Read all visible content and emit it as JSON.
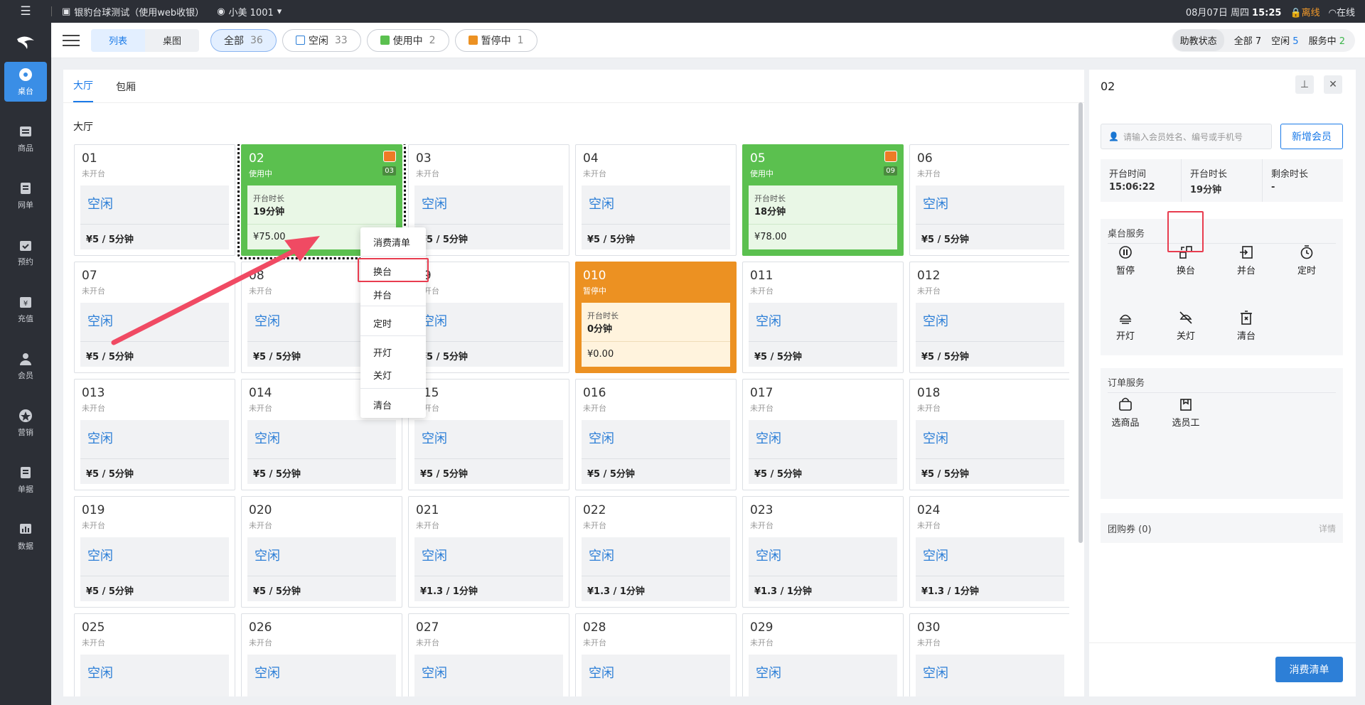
{
  "topbar": {
    "store": "银豹台球测试（使用web收银）",
    "user": "小美 1001",
    "date": "08月07日 周四",
    "time": "15:25",
    "offline": "离线",
    "online": "在线"
  },
  "sidebar": [
    {
      "label": "桌台",
      "icon": "table-icon"
    },
    {
      "label": "商品",
      "icon": "goods-icon"
    },
    {
      "label": "网单",
      "icon": "online-order-icon"
    },
    {
      "label": "预约",
      "icon": "calendar-icon"
    },
    {
      "label": "充值",
      "icon": "recharge-icon"
    },
    {
      "label": "会员",
      "icon": "member-icon"
    },
    {
      "label": "营销",
      "icon": "star-icon"
    },
    {
      "label": "单据",
      "icon": "document-icon"
    },
    {
      "label": "数据",
      "icon": "chart-icon"
    }
  ],
  "header": {
    "view_list": "列表",
    "view_table": "桌图",
    "filters": [
      {
        "label": "全部",
        "count": "36"
      },
      {
        "label": "空闲",
        "count": "33"
      },
      {
        "label": "使用中",
        "count": "2"
      },
      {
        "label": "暂停中",
        "count": "1"
      }
    ],
    "assist": {
      "label": "助教状态",
      "all": "全部",
      "all_count": "7",
      "idle": "空闲",
      "idle_count": "5",
      "serving": "服务中",
      "serving_count": "2"
    }
  },
  "tabs": [
    "大厅",
    "包厢"
  ],
  "section": "大厅",
  "status_text": {
    "idle": "未开台",
    "using": "使用中",
    "paused": "暂停中",
    "idle_big": "空闲",
    "duration_label": "开台时长"
  },
  "tables": [
    {
      "name": "01",
      "state": "idle",
      "price": "¥5 / 5分钟"
    },
    {
      "name": "02",
      "state": "using",
      "duration": "19分钟",
      "amount": "¥75.00",
      "badge": "03",
      "selected": true
    },
    {
      "name": "03",
      "state": "idle",
      "price": "¥5 / 5分钟"
    },
    {
      "name": "04",
      "state": "idle",
      "price": "¥5 / 5分钟"
    },
    {
      "name": "05",
      "state": "using",
      "duration": "18分钟",
      "amount": "¥78.00",
      "badge": "09"
    },
    {
      "name": "06",
      "state": "idle",
      "price": "¥5 / 5分钟"
    },
    {
      "name": "07",
      "state": "idle",
      "price": "¥5 / 5分钟"
    },
    {
      "name": "08",
      "state": "idle",
      "price": "¥5 / 5分钟"
    },
    {
      "name": "09",
      "state": "idle",
      "price": "¥5 / 5分钟"
    },
    {
      "name": "010",
      "state": "paused",
      "duration": "0分钟",
      "amount": "¥0.00"
    },
    {
      "name": "011",
      "state": "idle",
      "price": "¥5 / 5分钟"
    },
    {
      "name": "012",
      "state": "idle",
      "price": "¥5 / 5分钟"
    },
    {
      "name": "013",
      "state": "idle",
      "price": "¥5 / 5分钟"
    },
    {
      "name": "014",
      "state": "idle",
      "price": "¥5 / 5分钟"
    },
    {
      "name": "015",
      "state": "idle",
      "price": "¥5 / 5分钟"
    },
    {
      "name": "016",
      "state": "idle",
      "price": "¥5 / 5分钟"
    },
    {
      "name": "017",
      "state": "idle",
      "price": "¥5 / 5分钟"
    },
    {
      "name": "018",
      "state": "idle",
      "price": "¥5 / 5分钟"
    },
    {
      "name": "019",
      "state": "idle",
      "price": "¥5 / 5分钟"
    },
    {
      "name": "020",
      "state": "idle",
      "price": "¥5 / 5分钟"
    },
    {
      "name": "021",
      "state": "idle",
      "price": "¥1.3 / 1分钟"
    },
    {
      "name": "022",
      "state": "idle",
      "price": "¥1.3 / 1分钟"
    },
    {
      "name": "023",
      "state": "idle",
      "price": "¥1.3 / 1分钟"
    },
    {
      "name": "024",
      "state": "idle",
      "price": "¥1.3 / 1分钟"
    },
    {
      "name": "025",
      "state": "idle",
      "price": ""
    },
    {
      "name": "026",
      "state": "idle",
      "price": ""
    },
    {
      "name": "027",
      "state": "idle",
      "price": ""
    },
    {
      "name": "028",
      "state": "idle",
      "price": ""
    },
    {
      "name": "029",
      "state": "idle",
      "price": ""
    },
    {
      "name": "030",
      "state": "idle",
      "price": ""
    }
  ],
  "context_menu": [
    "消费清单",
    "换台",
    "并台",
    "定时",
    "开灯",
    "关灯",
    "清台"
  ],
  "panel": {
    "title": "02",
    "search_placeholder": "请输入会员姓名、编号或手机号",
    "new_member": "新增会员",
    "start_time_label": "开台时间",
    "start_time": "15:06:22",
    "duration_label": "开台时长",
    "duration": "19分钟",
    "remaining_label": "剩余时长",
    "remaining": "-",
    "table_services_title": "桌台服务",
    "table_services": [
      {
        "label": "暂停",
        "icon": "pause-icon"
      },
      {
        "label": "换台",
        "icon": "swap-table-icon"
      },
      {
        "label": "并台",
        "icon": "merge-table-icon"
      },
      {
        "label": "定时",
        "icon": "timer-icon"
      },
      {
        "label": "开灯",
        "icon": "light-on-icon"
      },
      {
        "label": "关灯",
        "icon": "light-off-icon"
      },
      {
        "label": "清台",
        "icon": "clear-table-icon"
      }
    ],
    "order_services_title": "订单服务",
    "order_services": [
      {
        "label": "选商品",
        "icon": "shopping-bag-icon"
      },
      {
        "label": "选员工",
        "icon": "staff-icon"
      }
    ],
    "group_coupon": "团购券 (0)",
    "details": "详情",
    "bill_button": "消费清单"
  },
  "colors": {
    "primary": "#2d7fd7",
    "using": "#5bc04f",
    "paused": "#ec9122",
    "highlight": "#e83c4f",
    "sidebar": "#2c2f36"
  }
}
